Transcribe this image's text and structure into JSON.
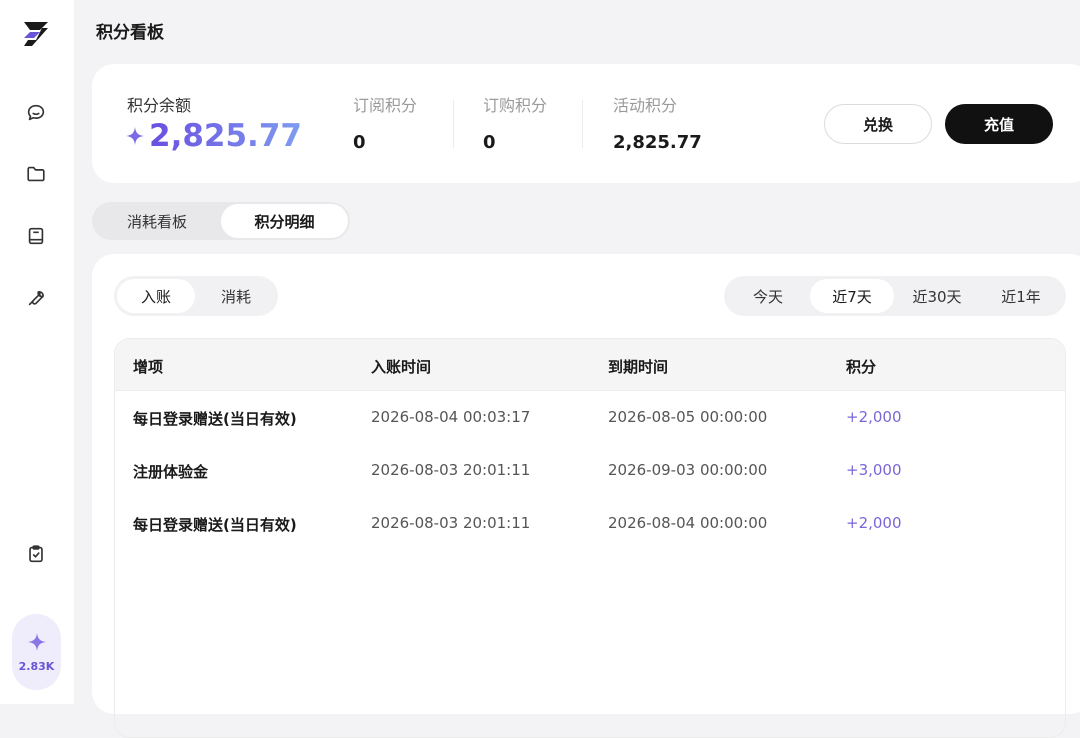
{
  "app": {
    "page_title": "积分看板",
    "credit_badge": "2.83K"
  },
  "sidebar": {
    "items": [
      {
        "icon": "chat-icon"
      },
      {
        "icon": "folder-icon"
      },
      {
        "icon": "book-icon"
      },
      {
        "icon": "wrench-icon"
      },
      {
        "icon": "clipboard-check-icon"
      }
    ]
  },
  "summary": {
    "balance_label": "积分余额",
    "balance_value": "2,825.77",
    "stats": [
      {
        "label": "订阅积分",
        "value": "0"
      },
      {
        "label": "订购积分",
        "value": "0"
      },
      {
        "label": "活动积分",
        "value": "2,825.77"
      }
    ],
    "exchange_label": "兑换",
    "recharge_label": "充值"
  },
  "tabs": {
    "consumption": "消耗看板",
    "details": "积分明细",
    "active": "details"
  },
  "filters": {
    "income": "入账",
    "consume": "消耗",
    "active_type": "income",
    "ranges": [
      "今天",
      "近7天",
      "近30天",
      "近1年"
    ],
    "active_range": "近7天"
  },
  "table": {
    "headers": {
      "item": "增项",
      "credited": "入账时间",
      "expires": "到期时间",
      "points": "积分"
    },
    "rows": [
      {
        "item": "每日登录赠送(当日有效)",
        "credited": "2026-08-04 00:03:17",
        "expires": "2026-08-05 00:00:00",
        "points": "+2,000"
      },
      {
        "item": "注册体验金",
        "credited": "2026-08-03 20:01:11",
        "expires": "2026-09-03 00:00:00",
        "points": "+3,000"
      },
      {
        "item": "每日登录赠送(当日有效)",
        "credited": "2026-08-03 20:01:11",
        "expires": "2026-08-04 00:00:00",
        "points": "+2,000"
      }
    ]
  },
  "colors": {
    "accent": "#7b66d8",
    "primary_button": "#111111"
  }
}
